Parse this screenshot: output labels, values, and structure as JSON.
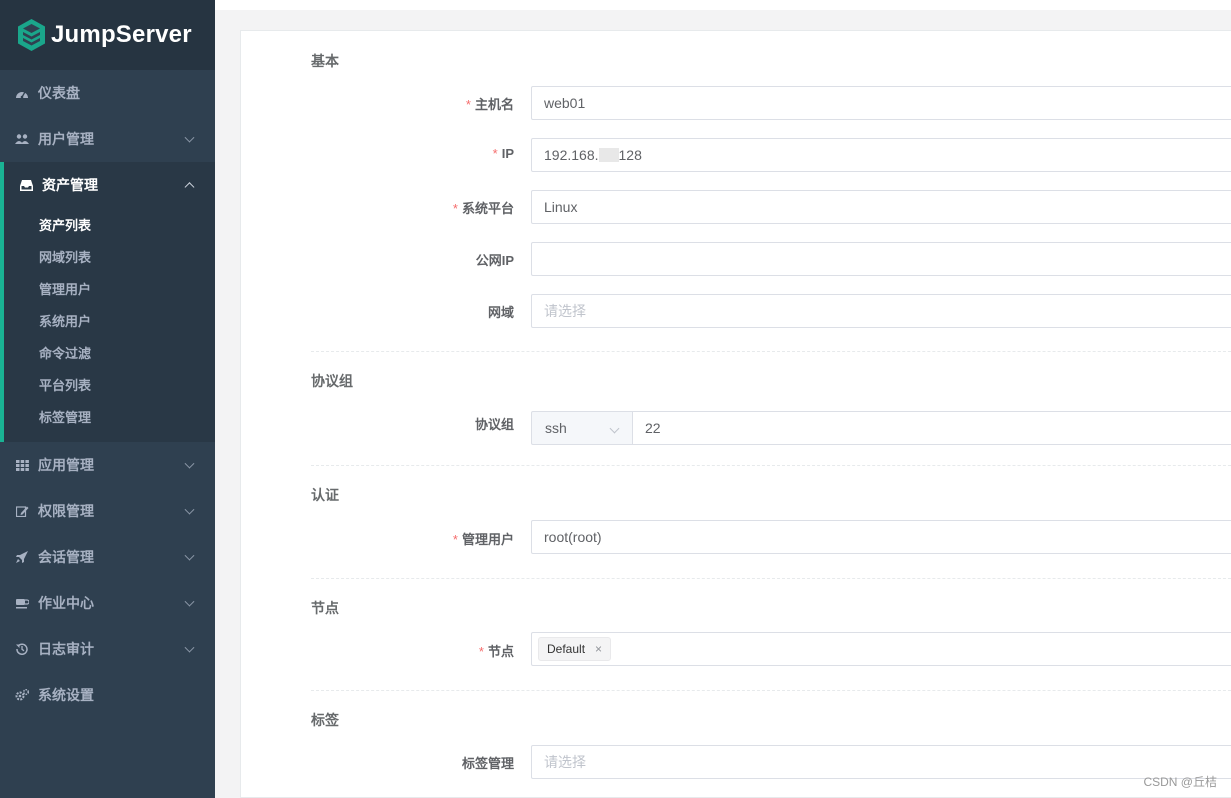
{
  "brand": {
    "name": "JumpServer"
  },
  "sidebar": {
    "items_top": [
      {
        "label": "仪表盘",
        "icon": "dashboard-icon"
      },
      {
        "label": "用户管理",
        "icon": "users-icon"
      }
    ],
    "open_group": {
      "label": "资产管理",
      "icon": "inbox-icon",
      "items": [
        "资产列表",
        "网域列表",
        "管理用户",
        "系统用户",
        "命令过滤",
        "平台列表",
        "标签管理"
      ],
      "active": "资产列表"
    },
    "items_bottom": [
      {
        "label": "应用管理",
        "icon": "grid-icon"
      },
      {
        "label": "权限管理",
        "icon": "edit-icon"
      },
      {
        "label": "会话管理",
        "icon": "rocket-icon"
      },
      {
        "label": "作业中心",
        "icon": "coffee-icon"
      },
      {
        "label": "日志审计",
        "icon": "history-icon"
      },
      {
        "label": "系统设置",
        "icon": "gears-icon"
      }
    ]
  },
  "form": {
    "sections": {
      "basic": "基本",
      "protocols": "协议组",
      "auth": "认证",
      "nodes": "节点",
      "labels": "标签"
    },
    "hostname": {
      "label": "主机名",
      "value": "web01"
    },
    "ip": {
      "label": "IP",
      "value_prefix": "192.168.",
      "value_suffix": "128"
    },
    "platform": {
      "label": "系统平台",
      "value": "Linux"
    },
    "public_ip": {
      "label": "公网IP",
      "value": ""
    },
    "domain": {
      "label": "网域",
      "placeholder": "请选择"
    },
    "protocol": {
      "label": "协议组",
      "name": "ssh",
      "port": "22"
    },
    "admin_user": {
      "label": "管理用户",
      "value": "root(root)"
    },
    "node": {
      "label": "节点",
      "tag": "Default",
      "remove": "×"
    },
    "tags": {
      "label": "标签管理",
      "placeholder": "请选择"
    }
  },
  "watermark": "CSDN @丘桔",
  "colors": {
    "sidebar": "#2f4050",
    "accent": "#1ab394",
    "required": "#f56c6c"
  }
}
